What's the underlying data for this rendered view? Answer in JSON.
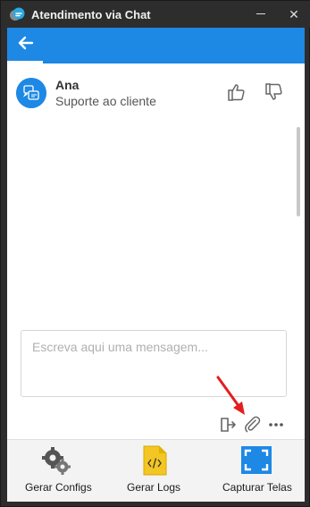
{
  "window": {
    "title": "Atendimento via Chat",
    "minimize_glyph": "—",
    "close_glyph": "✕"
  },
  "header": {
    "back_icon": "arrow-left-icon",
    "accent_color": "#1e88e5"
  },
  "agent": {
    "name": "Ana",
    "role": "Suporte ao cliente",
    "rate_up_icon": "thumbs-up-icon",
    "rate_down_icon": "thumbs-down-icon"
  },
  "composer": {
    "placeholder": "Escreva aqui uma mensagem...",
    "value": "",
    "actions": [
      "exit-icon",
      "paperclip-icon",
      "more-icon"
    ]
  },
  "toolbar": {
    "items": [
      {
        "label": "Gerar Configs",
        "icon": "gear-icon"
      },
      {
        "label": "Gerar Logs",
        "icon": "code-file-icon"
      },
      {
        "label": "Capturar Telas",
        "icon": "screen-capture-icon"
      }
    ]
  }
}
